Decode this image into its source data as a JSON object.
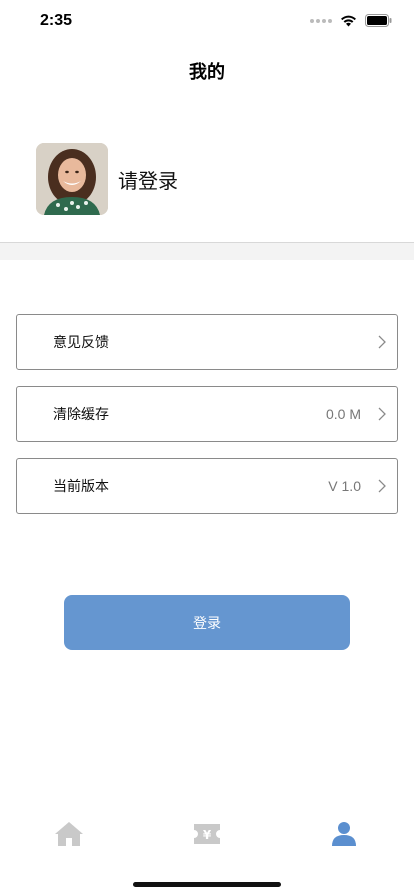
{
  "status_bar": {
    "time": "2:35"
  },
  "nav": {
    "title": "我的"
  },
  "profile": {
    "login_prompt": "请登录",
    "avatar_icon": "user-photo"
  },
  "menu": {
    "items": [
      {
        "label": "意见反馈",
        "value": ""
      },
      {
        "label": "清除缓存",
        "value": "0.0 M"
      },
      {
        "label": "当前版本",
        "value": "V 1.0"
      }
    ]
  },
  "login_button": {
    "label": "登录"
  },
  "tab_bar": {
    "tabs": [
      {
        "icon": "home-icon",
        "active": false
      },
      {
        "icon": "ticket-yen-icon",
        "active": false
      },
      {
        "icon": "person-icon",
        "active": true
      }
    ],
    "active_color": "#5b8fcf",
    "inactive_color": "#c9c9c9"
  },
  "colors": {
    "accent": "#6596d0"
  }
}
